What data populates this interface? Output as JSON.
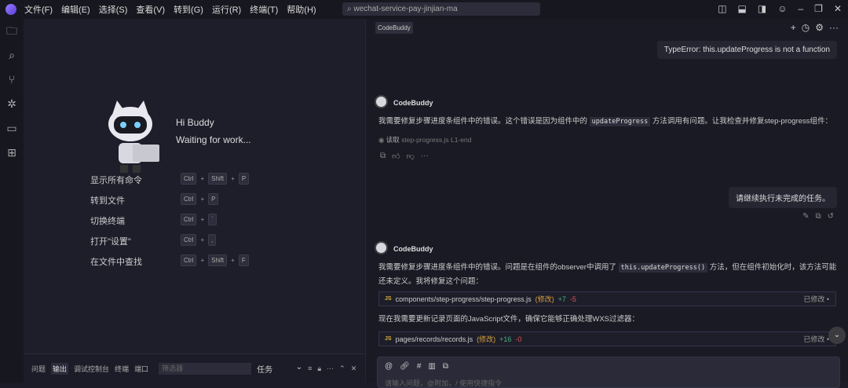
{
  "titlebar": {
    "menus": [
      "文件(F)",
      "编辑(E)",
      "选择(S)",
      "查看(V)",
      "转到(G)",
      "运行(R)",
      "终端(T)",
      "帮助(H)"
    ],
    "search": "wechat-service-pay-jinjian-ma"
  },
  "welcome": {
    "greeting": "Hi Buddy",
    "status": "Waiting for work...",
    "shortcuts": [
      {
        "label": "显示所有命令",
        "keys": [
          "Ctrl",
          "Shift",
          "P"
        ]
      },
      {
        "label": "转到文件",
        "keys": [
          "Ctrl",
          "P"
        ]
      },
      {
        "label": "切换终端",
        "keys": [
          "Ctrl",
          "`"
        ]
      },
      {
        "label": "打开\"设置\"",
        "keys": [
          "Ctrl",
          ","
        ]
      },
      {
        "label": "在文件中查找",
        "keys": [
          "Ctrl",
          "Shift",
          "F"
        ]
      }
    ]
  },
  "panel": {
    "tabs": [
      "问题",
      "输出",
      "调试控制台",
      "终端",
      "端口"
    ],
    "filter_placeholder": "筛选器",
    "task": "任务"
  },
  "chat": {
    "tag": "CodeBuddy",
    "error_msg": "TypeError: this.updateProgress is not a function",
    "msg1": {
      "author": "CodeBuddy",
      "pre": "我需要修复步骤进度条组件中的错误。这个错误是因为组件中的 ",
      "code": "updateProgress",
      "post": " 方法调用有问题。让我检查并修复step-progress组件：",
      "tool_action": "读取",
      "tool_target": "step-progress.js L1-end"
    },
    "user_msg": "请继续执行未完成的任务。",
    "msg2": {
      "author": "CodeBuddy",
      "pre": "我需要修复步骤进度条组件中的错误。问题是在组件的observer中调用了 ",
      "code": "this.updateProgress()",
      "post": " 方法，但在组件初始化时，该方法可能还未定义。我将修复这个问题：",
      "between": "现在我需要更新记录页面的JavaScript文件，确保它能够正确处理WXS过滤器："
    },
    "files": [
      {
        "badge": "JS",
        "path": "components/step-progress/step-progress.js",
        "state": "(修改)",
        "add": "+7",
        "del": "-5",
        "status": "已修改 •"
      },
      {
        "badge": "JS",
        "path": "pages/records/records.js",
        "state": "(修改)",
        "add": "+16",
        "del": "-0",
        "status": "已修改 •"
      }
    ],
    "input_placeholder": "请输入问题，@附加，/ 使用快捷指令"
  }
}
